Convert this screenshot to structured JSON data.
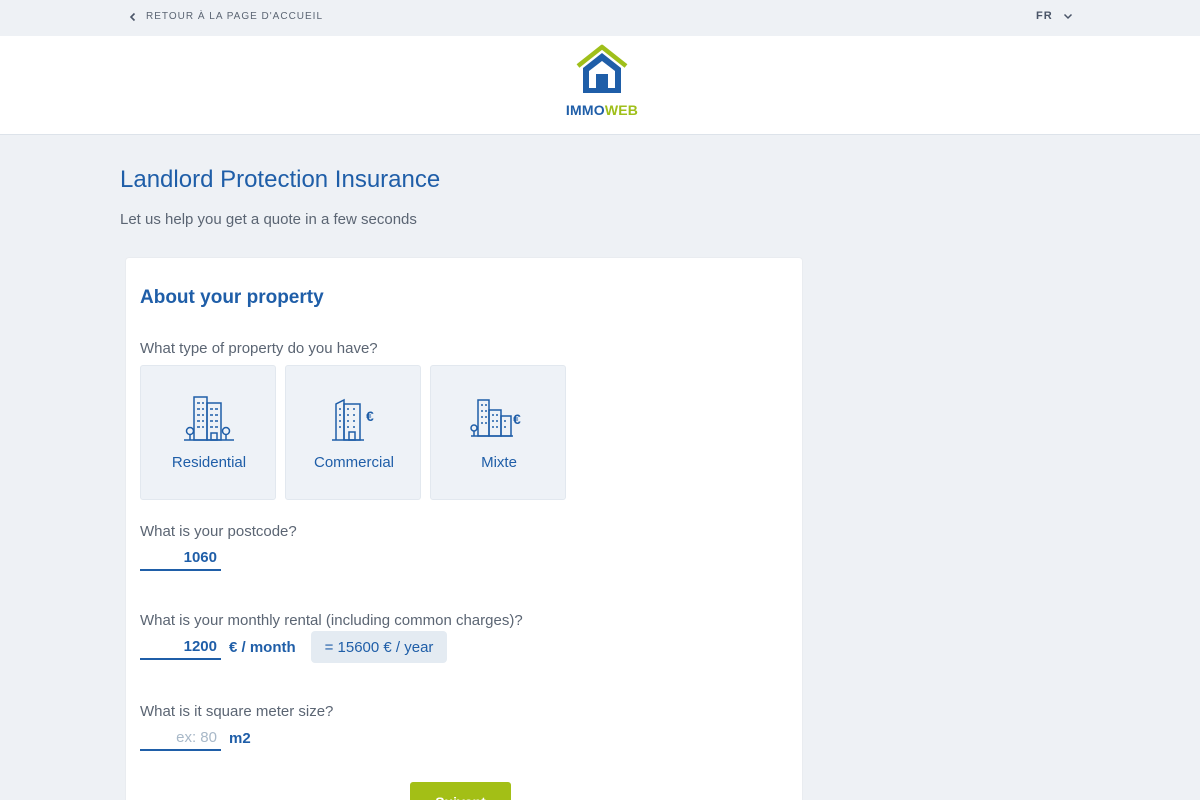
{
  "topbar": {
    "back_label": "RETOUR À LA PAGE D'ACCUEIL",
    "language": "FR"
  },
  "logo": {
    "text_part1": "IMMO",
    "text_part2": "WEB",
    "colors": {
      "blue": "#1f5ea8",
      "green": "#9fbf1a"
    }
  },
  "page": {
    "title": "Landlord Protection Insurance",
    "subtitle": "Let us help you get a quote in a few seconds"
  },
  "form": {
    "section_title": "About your property",
    "property_type": {
      "question": "What type of property do you have?",
      "options": [
        {
          "label": "Residential",
          "icon": "residential-building-icon"
        },
        {
          "label": "Commercial",
          "icon": "commercial-building-icon"
        },
        {
          "label": "Mixte",
          "icon": "mixed-building-icon"
        }
      ]
    },
    "postcode": {
      "question": "What is your postcode?",
      "value": "1060"
    },
    "rent": {
      "question": "What is your monthly rental (including common charges)?",
      "value": "1200",
      "unit": "€ / month",
      "annual": "= 15600 € / year"
    },
    "size": {
      "question": "What is it square meter size?",
      "placeholder": "ex: 80",
      "unit": "m2"
    },
    "next_button": "Suivant"
  },
  "colors": {
    "accent": "#1f5ea8",
    "button": "#a3bf16",
    "background": "#eef1f5"
  }
}
